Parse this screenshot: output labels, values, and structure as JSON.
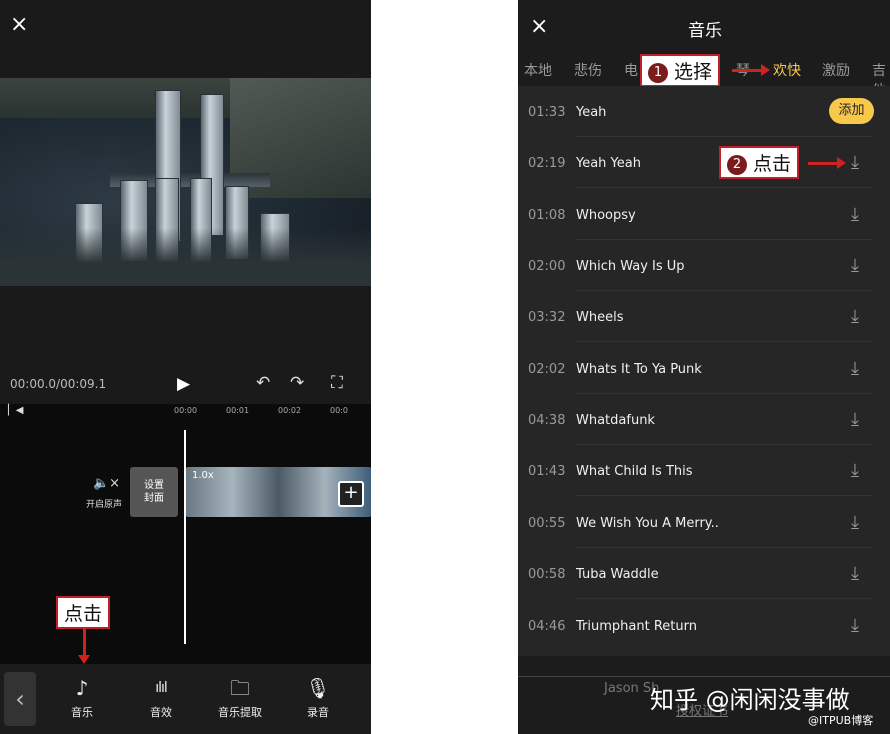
{
  "left": {
    "close_icon": "×",
    "time_display": "00:00.0/00:09.1",
    "play_icon": "▶",
    "undo_icon": "↶",
    "redo_icon": "↷",
    "fullscreen_icon": "⛶",
    "ruler": [
      "00:00",
      "00:01",
      "00:02",
      "00:0"
    ],
    "mute_label": "开启原声",
    "mute_icon": "🔈×",
    "cover_label": "设置\n封面",
    "speed_label": "1.0x",
    "add_clip_icon": "+",
    "callout": "点击",
    "back_icon": "‹",
    "tools": [
      {
        "label": "音乐",
        "icon": "♪"
      },
      {
        "label": "音效",
        "icon": "ılıl"
      },
      {
        "label": "音乐提取",
        "icon": "🗀"
      },
      {
        "label": "录音",
        "icon": "🎙"
      }
    ]
  },
  "right": {
    "close_icon": "×",
    "title": "音乐",
    "tabs": [
      "本地",
      "悲伤",
      "电",
      "琴",
      "欢快",
      "激励",
      "吉他"
    ],
    "active_tab": "欢快",
    "active_color": "#f7c84a",
    "callout1": "选择",
    "callout1_num": "1",
    "callout2": "点击",
    "callout2_num": "2",
    "add_label": "添加",
    "download_icon": "⤓",
    "tracks": [
      {
        "duration": "01:33",
        "name": "Yeah"
      },
      {
        "duration": "02:19",
        "name": "Yeah Yeah"
      },
      {
        "duration": "01:08",
        "name": "Whoopsy"
      },
      {
        "duration": "02:00",
        "name": "Which Way Is Up"
      },
      {
        "duration": "03:32",
        "name": "Wheels"
      },
      {
        "duration": "02:02",
        "name": "Whats It To Ya Punk"
      },
      {
        "duration": "04:38",
        "name": "Whatdafunk"
      },
      {
        "duration": "01:43",
        "name": "What Child Is This"
      },
      {
        "duration": "00:55",
        "name": "We Wish You A Merry.."
      },
      {
        "duration": "00:58",
        "name": "Tuba Waddle"
      },
      {
        "duration": "04:46",
        "name": "Triumphant Return"
      }
    ],
    "footer_artist": "Jason Sh",
    "footer_license": "授权证书",
    "watermark": "知乎 @闲闲没事做",
    "watermark2": "@ITPUB博客"
  }
}
